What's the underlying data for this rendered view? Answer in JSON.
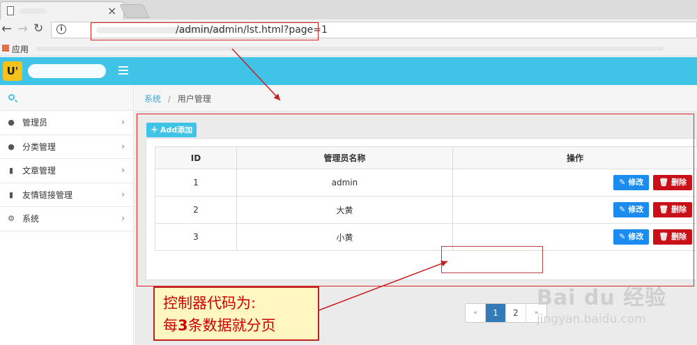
{
  "browser": {
    "tab_close": "×",
    "url": "/admin/admin/lst.html?page=1",
    "apps_label": "应用"
  },
  "header": {
    "logo_text": "U'"
  },
  "sidebar": {
    "items": [
      {
        "icon": "user-icon",
        "label": "管理员"
      },
      {
        "icon": "user-icon",
        "label": "分类管理"
      },
      {
        "icon": "document-icon",
        "label": "文章管理"
      },
      {
        "icon": "document-icon",
        "label": "友情链接管理"
      },
      {
        "icon": "gear-icon",
        "label": "系统"
      }
    ]
  },
  "breadcrumb": {
    "root": "系统",
    "separator": "/",
    "current": "用户管理"
  },
  "toolbar": {
    "add_label": "Add添加"
  },
  "table": {
    "headers": [
      "ID",
      "管理员名称",
      "操作"
    ],
    "rows": [
      {
        "id": "1",
        "name": "admin"
      },
      {
        "id": "2",
        "name": "大黄"
      },
      {
        "id": "3",
        "name": "小黄"
      }
    ],
    "edit_label": "修改",
    "delete_label": "删除"
  },
  "pagination": {
    "prev": "«",
    "pages": [
      "1",
      "2"
    ],
    "current": "1",
    "next": "»"
  },
  "annotation": {
    "line1": "控制器代码为:",
    "line2_prefix": "每",
    "line2_number": "3",
    "line2_suffix": "条数据就分页"
  },
  "watermark": {
    "logo": "Bai du 经验",
    "sub": "jingyan.baidu.com"
  },
  "colors": {
    "header": "#3fc3e6",
    "edit": "#1b8bef",
    "delete": "#c9111a",
    "page_active": "#337ab7",
    "annotation_red": "#d00000"
  }
}
